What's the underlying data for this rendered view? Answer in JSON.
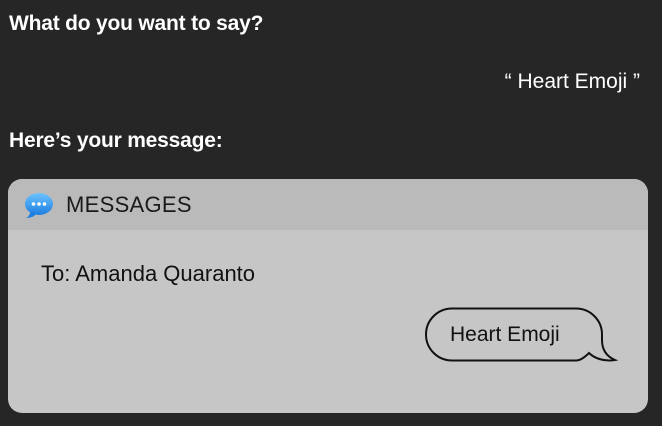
{
  "siri": {
    "prompt": "What do you want to say?",
    "utterance": "“ Heart Emoji ”",
    "response": "Here’s your message:"
  },
  "message_card": {
    "app_icon": "messages-app-icon",
    "app_name": "MESSAGES",
    "recipient": "To: Amanda Quaranto",
    "message_text": "Heart Emoji"
  },
  "colors": {
    "background": "#262626",
    "card": "#c6c6c6",
    "card_header": "#bababa",
    "messages_blue": "#2f8fe8"
  }
}
